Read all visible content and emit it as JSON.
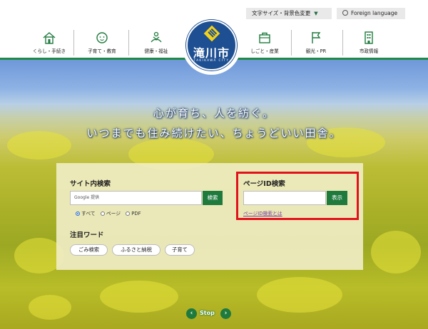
{
  "header": {
    "text_size_label": "文字サイズ・背景色変更",
    "text_size_caret": "▼",
    "foreign_language_label": "Foreign language",
    "nav": [
      {
        "label": "くらし・手続き",
        "icon": "house-icon"
      },
      {
        "label": "子育て・教育",
        "icon": "baby-icon"
      },
      {
        "label": "健康・福祉",
        "icon": "care-icon"
      },
      {
        "label": "しごと・産業",
        "icon": "briefcase-icon"
      },
      {
        "label": "観光・PR",
        "icon": "flag-icon"
      },
      {
        "label": "市政情報",
        "icon": "building-icon"
      }
    ],
    "logo": {
      "name": "滝川市",
      "romaji": "TAKIKAWA CITY"
    }
  },
  "hero": {
    "tagline_1": "心が育ち、人を紡ぐ。",
    "tagline_2": "いつまでも住み続けたい、ちょうどいい田舎。"
  },
  "search": {
    "site_search_title": "サイト内検索",
    "site_search_placeholder": "Google 提供",
    "site_search_button": "検索",
    "radio_options": [
      "すべて",
      "ページ",
      "PDF"
    ],
    "radio_selected": "すべて",
    "page_id_title": "ページID検索",
    "page_id_value": "",
    "page_id_button": "表示",
    "page_id_help_link": "ページID検索とは",
    "popular_words_title": "注目ワード",
    "popular_words": [
      "ごみ検索",
      "ふるさと納税",
      "子育て"
    ]
  },
  "slider": {
    "prev_symbol": "‹",
    "stop_label": "Stop",
    "next_symbol": "›"
  },
  "colors": {
    "brand_green": "#1f7a3e",
    "logo_blue": "#1d4f92",
    "highlight_red": "#e1121b"
  }
}
